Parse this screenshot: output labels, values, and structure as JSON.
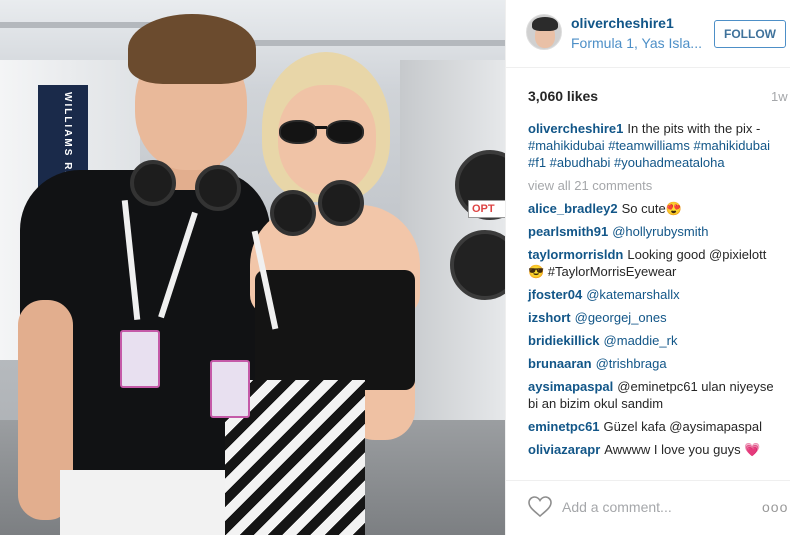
{
  "photo": {
    "wall_text": "WILLIAMS RAC",
    "sign_text": "OPT"
  },
  "post": {
    "username": "olivercheshire1",
    "location": "Formula 1, Yas Isla...",
    "follow_label": "FOLLOW",
    "likes": "3,060 likes",
    "time": "1w",
    "caption": {
      "user": "olivercheshire1",
      "text": "In the pits with the pix -",
      "tags": "#mahikidubai #teamwilliams #mahikidubai #f1 #abudhabi #youhadmeataloha"
    },
    "view_all": "view all 21 comments",
    "comments": [
      {
        "user": "alice_bradley2",
        "text": "So cute😍"
      },
      {
        "user": "pearlsmith91",
        "text": "@hollyrubysmith"
      },
      {
        "user": "taylormorrisldn",
        "text": "Looking good @pixielott 😎 #TaylorMorrisEyewear"
      },
      {
        "user": "jfoster04",
        "text": "@katemarshallx"
      },
      {
        "user": "izshort",
        "text": "@georgej_ones"
      },
      {
        "user": "bridiekillick",
        "text": "@maddie_rk"
      },
      {
        "user": "brunaaran",
        "text": "@trishbraga"
      },
      {
        "user": "aysimapaspal",
        "text": "@eminetpc61 ulan niyeyse bi an bizim okul sandim"
      },
      {
        "user": "eminetpc61",
        "text": "Güzel kafa @aysimapaspal"
      },
      {
        "user": "oliviazarapr",
        "text": "Awwww I love you guys 💗"
      }
    ],
    "add_comment_placeholder": "Add a comment...",
    "more_label": "ooo",
    "colors": {
      "link": "#125688",
      "follow_border": "#4d8fc7",
      "muted": "#a5a7aa"
    }
  }
}
